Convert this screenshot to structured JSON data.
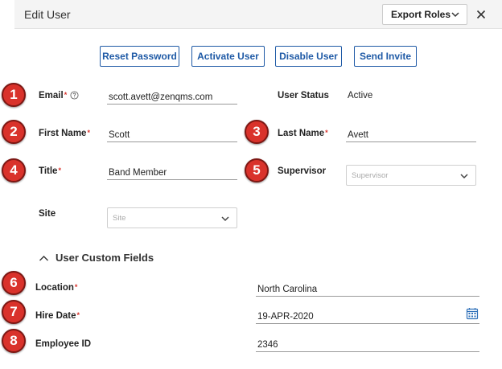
{
  "header": {
    "title": "Edit User",
    "export_roles_label": "Export Roles"
  },
  "actions": {
    "reset_password": "Reset Password",
    "activate_user": "Activate User",
    "disable_user": "Disable User",
    "send_invite": "Send Invite"
  },
  "badges": [
    "1",
    "2",
    "3",
    "4",
    "5",
    "6",
    "7",
    "8"
  ],
  "form": {
    "email": {
      "label": "Email",
      "required": "*",
      "value": "scott.avett@zenqms.com"
    },
    "user_status": {
      "label": "User Status",
      "value": "Active"
    },
    "first_name": {
      "label": "First Name",
      "required": "*",
      "value": "Scott"
    },
    "last_name": {
      "label": "Last Name",
      "required": "*",
      "value": "Avett"
    },
    "title": {
      "label": "Title",
      "required": "*",
      "value": "Band Member"
    },
    "supervisor": {
      "label": "Supervisor",
      "placeholder": "Supervisor"
    },
    "site": {
      "label": "Site",
      "placeholder": "Site"
    }
  },
  "custom_fields": {
    "section_title": "User Custom Fields",
    "location": {
      "label": "Location",
      "required": "*",
      "value": "North Carolina"
    },
    "hire_date": {
      "label": "Hire Date",
      "required": "*",
      "value": "19-APR-2020"
    },
    "employee_id": {
      "label": "Employee ID",
      "value": "2346"
    }
  },
  "icons": {
    "help": "help-circle-icon",
    "calendar": "calendar-icon",
    "close": "close-icon",
    "chevron": "chevron-down-icon",
    "collapse": "chevron-up-icon"
  },
  "colors": {
    "accent": "#1f5aa6",
    "badge": "#d9322b",
    "required": "#d9322b",
    "header_bg": "#f4f4f4"
  }
}
